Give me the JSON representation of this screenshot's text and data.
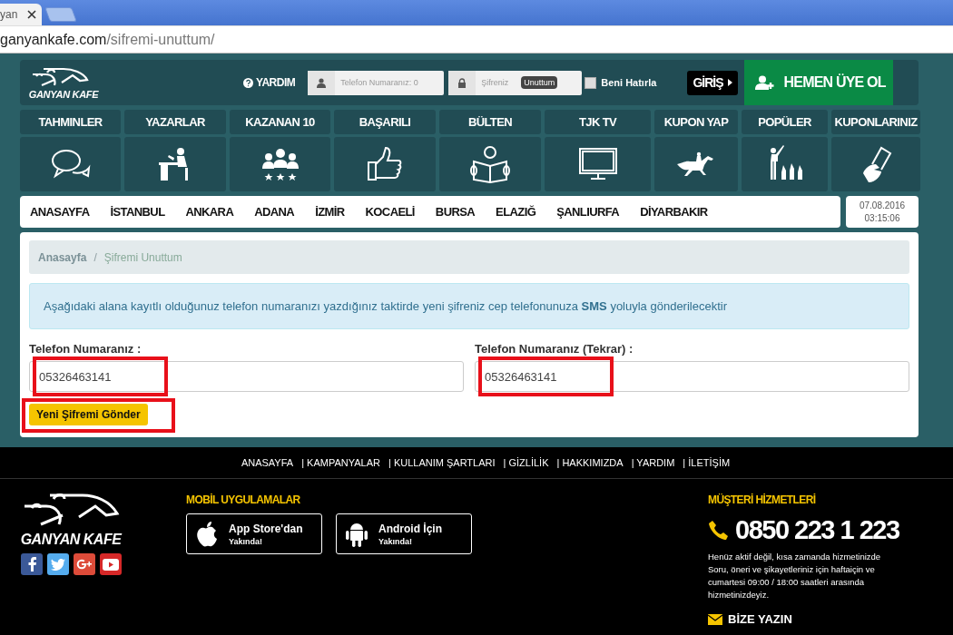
{
  "browser": {
    "tab_title": "yan",
    "url_domain": "ganyankafe.com",
    "url_path": "/sifremi-unuttum/"
  },
  "header": {
    "logo": "GANYAN KAFE",
    "help": "YARDIM",
    "phone_placeholder": "Telefon Numaranız: 0",
    "password_placeholder": "Şifreniz",
    "forgot": "Unuttum",
    "remember": {
      "label": "Beni Hatırla",
      "checked": false
    },
    "login": "GİRİŞ",
    "signup": "HEMEN ÜYE OL"
  },
  "nav": [
    {
      "label": "TAHMINLER"
    },
    {
      "label": "YAZARLAR"
    },
    {
      "label": "KAZANAN 10"
    },
    {
      "label": "BAŞARILI"
    },
    {
      "label": "BÜLTEN"
    },
    {
      "label": "TJK TV"
    },
    {
      "label": "KUPON YAP"
    },
    {
      "label": "POPÜLER"
    },
    {
      "label": "KUPONLARINIZ"
    }
  ],
  "cities": [
    "ANASAYFA",
    "İSTANBUL",
    "ANKARA",
    "ADANA",
    "İZMİR",
    "KOCAELİ",
    "BURSA",
    "ELAZIĞ",
    "ŞANLIURFA",
    "DİYARBAKIR"
  ],
  "clock": {
    "date": "07.08.2016",
    "time": "03:15:06"
  },
  "breadcrumb": [
    "Anasayfa",
    "Şifremi Unuttum"
  ],
  "breadcrumb_separator": "/",
  "info": "Aşağıdaki alana kayıtlı olduğunuz telefon numaranızı  yazdığınız taktirde yeni şifreniz cep telefonunuza **SMS** yoluyla gönderilecektir",
  "fields": [
    {
      "label": "Telefon Numaranız :",
      "value": "05326463141",
      "highlighted": true
    },
    {
      "label": "Telefon Numaranız (Tekrar) :",
      "value": "05326463141",
      "highlighted": true
    }
  ],
  "submit": {
    "label": "Yeni Şifremi Gönder",
    "highlighted": true
  },
  "footer": {
    "links": [
      "ANASAYFA",
      "| KAMPANYALAR",
      "| KULLANIM ŞARTLARI",
      "| GİZLİLİK",
      "| HAKKIMIZDA",
      "| YARDIM",
      "| İLETİŞİM"
    ],
    "logo": "GANYAN KAFE",
    "mobile_title": "MOBİL UYGULAMALAR",
    "apps": [
      {
        "kind": "apple",
        "title": "App Store'dan",
        "subtitle": "Yakında!"
      },
      {
        "kind": "android",
        "title": "Android İçin",
        "subtitle": "Yakında!"
      }
    ],
    "support_title": "MÜŞTERİ HİZMETLERİ",
    "phone": "0850 223 1 223",
    "note": "Henüz aktif değil, kısa zamanda hizmetinizde Soru, öneri ve şikayetleriniz için haftaiçin ve cumartesi 09:00 / 18:00 saatleri arasında hizmetinizdeyiz.",
    "write_us": "BİZE YAZIN"
  }
}
